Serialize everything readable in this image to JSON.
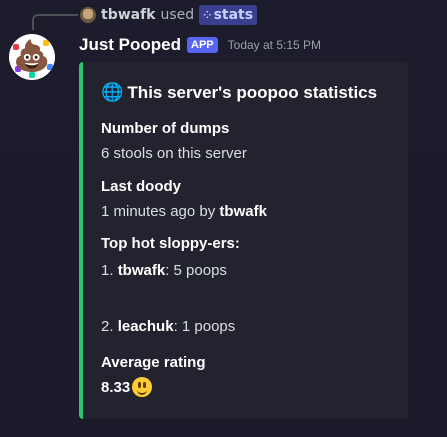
{
  "usage": {
    "user": "tbwafk",
    "used_text": "used",
    "command": "stats",
    "command_icon": "grid-dots"
  },
  "bot": {
    "name": "Just Pooped",
    "badge": "APP",
    "timestamp": "Today at 5:15 PM",
    "avatar_icon": "poop-icon"
  },
  "embed": {
    "accent_color": "#2ec56c",
    "title_icon": "globe-icon",
    "title": "This server's poopoo statistics",
    "fields": [
      {
        "name": "Number of dumps",
        "value": "6 stools on this server"
      },
      {
        "name": "Last doody",
        "value_prefix": "1 minutes ago by ",
        "value_bold": "tbwafk"
      },
      {
        "name": "Top hot sloppy-ers:"
      },
      {
        "name": "Average rating",
        "value": "8.33",
        "value_icon": "smiley-icon"
      }
    ],
    "top": [
      {
        "rank": "1. ",
        "user": "tbwafk",
        "score": ": 5 poops"
      },
      {
        "rank": "2. ",
        "user": "leachuk",
        "score": ": 1 poops"
      }
    ]
  }
}
